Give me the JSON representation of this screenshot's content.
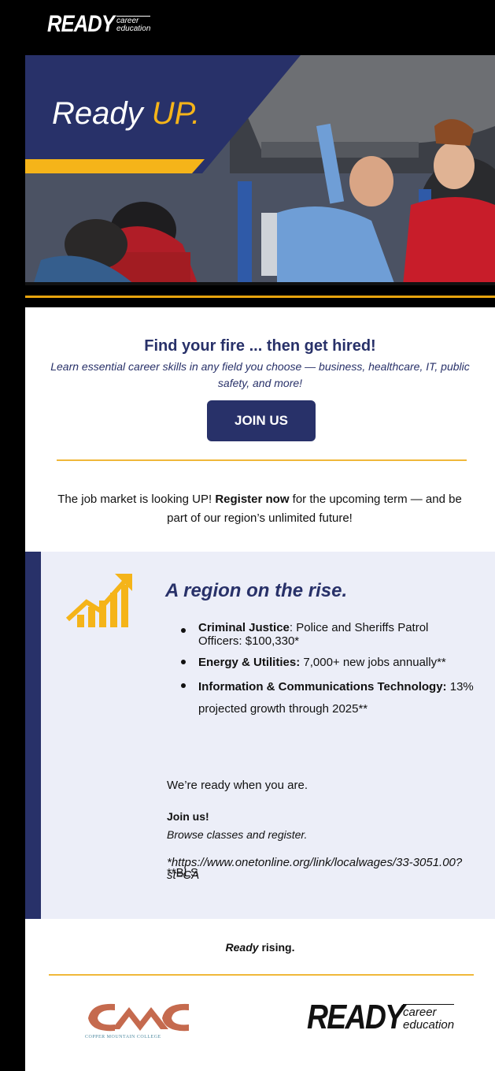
{
  "header": {
    "brand_big": "READY",
    "brand_small_line1": "career",
    "brand_small_line2": "education"
  },
  "hero": {
    "title_main": "Ready ",
    "title_accent": "UP."
  },
  "intro": {
    "headline": "Find your fire ... then get hired!",
    "subline": "Learn essential career skills in any field you choose — business, healthcare, IT, public safety, and more!",
    "join_button": "JOIN US",
    "market_prefix": "The job market is looking UP! ",
    "market_bold": "Register now",
    "market_suffix": " for the upcoming term — and be part of our region’s unlimited future!"
  },
  "rise": {
    "title": "A region on the rise.",
    "items": [
      {
        "bold": "Criminal Justice",
        "text": ": Police and Sheriffs Patrol Officers: $100,330*"
      },
      {
        "bold": "Energy & Utilities:",
        "text": " 7,000+ new jobs annually**"
      },
      {
        "bold": "Information & Communications Technology:",
        "text": " 13% projected growth through 2025**"
      }
    ],
    "ready_when": "We’re ready when you are.",
    "join_us": "Join us!",
    "browse": "Browse classes and register.",
    "footnote1": "*https://www.onetonline.org/link/localwages/33-3051.00?st=CA",
    "footnote2": "**BLS"
  },
  "footer": {
    "ready_italic": "Ready",
    "ready_rest": " rising.",
    "college_caption": "Copper Mountain College",
    "brand_big": "READY",
    "brand_small_line1": "career",
    "brand_small_line2": "education"
  },
  "colors": {
    "navy": "#283169",
    "gold": "#f5b419",
    "panel_bg": "#eceef8"
  }
}
